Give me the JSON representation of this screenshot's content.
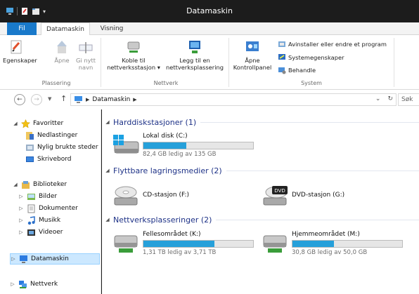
{
  "window": {
    "title": "Datamaskin"
  },
  "ribbon_tabs": {
    "file": "Fil",
    "active": "Datamaskin",
    "view": "Visning"
  },
  "ribbon": {
    "location": {
      "properties": "Egenskaper",
      "open": "Åpne",
      "rename_line1": "Gi nytt",
      "rename_line2": "navn",
      "group_label": "Plassering"
    },
    "network": {
      "map_drive_line1": "Koble til",
      "map_drive_line2": "nettverksstasjon",
      "add_location_line1": "Legg til en",
      "add_location_line2": "nettverksplassering",
      "group_label": "Nettverk"
    },
    "system": {
      "open_cp_line1": "Åpne",
      "open_cp_line2": "Kontrollpanel",
      "uninstall": "Avinstaller eller endre et program",
      "system_properties": "Systemegenskaper",
      "manage": "Behandle",
      "group_label": "System"
    }
  },
  "address": {
    "crumb": "Datamaskin",
    "search_placeholder": "Søk"
  },
  "nav": {
    "favorites": "Favoritter",
    "downloads": "Nedlastinger",
    "recent": "Nylig brukte steder",
    "desktop": "Skrivebord",
    "libraries": "Biblioteker",
    "pictures": "Bilder",
    "documents": "Dokumenter",
    "music": "Musikk",
    "videos": "Videoer",
    "computer": "Datamaskin",
    "network": "Nettverk"
  },
  "sections": {
    "hdd": "Harddiskstasjoner (1)",
    "removable": "Flyttbare lagringsmedier (2)",
    "network": "Nettverksplasseringer (2)"
  },
  "drives": {
    "local_c": {
      "name": "Lokal disk (C:)",
      "free_text": "82,4 GB ledig av 135 GB",
      "used_fraction": 0.39
    },
    "cd_f": {
      "name": "CD-stasjon (F:)"
    },
    "dvd_g": {
      "name": "DVD-stasjon (G:)",
      "badge": "DVD"
    },
    "shared_k": {
      "name": "Fellesområdet (K:)",
      "free_text": "1,31 TB ledig av 3,71 TB",
      "used_fraction": 0.65
    },
    "home_m": {
      "name": "Hjemmeområdet (M:)",
      "free_text": "30,8 GB ledig av 50,0 GB",
      "used_fraction": 0.38
    }
  },
  "colors": {
    "accent": "#1979ca",
    "bar_fill": "#26a0da",
    "section_text": "#1e3287",
    "selected_bg": "#cce8ff"
  }
}
